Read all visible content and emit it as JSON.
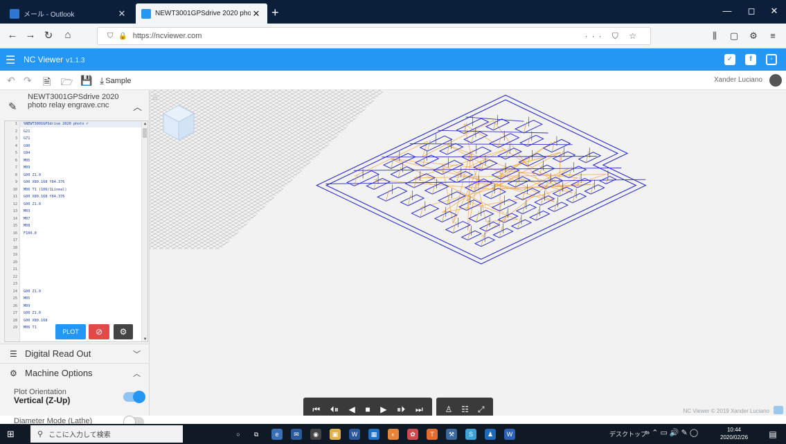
{
  "browser": {
    "tabs": [
      {
        "label": "メール - Outlook",
        "active": false
      },
      {
        "label": "NEWT3001GPSdrive 2020 pho",
        "active": true
      }
    ],
    "new_tab": "+",
    "url": "https://ncviewer.com",
    "window_controls": [
      "—",
      "◻",
      "✕"
    ]
  },
  "app": {
    "title": "NC Viewer",
    "version": "v1.1.3",
    "sample_label": "Sample",
    "user": "Xander Luciano",
    "colors": {
      "accent": "#2496f3",
      "toolpath_cut": "#2a2ad6",
      "toolpath_rapid": "#f2a23c",
      "plunge": "#c9a23a"
    }
  },
  "file": {
    "name": "NEWT3001GPSdrive 2020 photo relay engrave.cnc",
    "lines": [
      {
        "n": "1",
        "code": "%NEWT3001GPSdrive 2020 photo r"
      },
      {
        "n": "2",
        "code": "G21"
      },
      {
        "n": "3",
        "code": "G71"
      },
      {
        "n": "4",
        "code": "G90"
      },
      {
        "n": "5",
        "code": "G94"
      },
      {
        "n": "6",
        "code": "M05"
      },
      {
        "n": "7",
        "code": "M09"
      },
      {
        "n": "8",
        "code": "G00 Z1.0"
      },
      {
        "n": "9",
        "code": "G00 X80.168 Y84.376"
      },
      {
        "n": "10",
        "code": "M06 T1 (100/1Lineal)"
      },
      {
        "n": "11",
        "code": "G00 X80.168 Y84.376"
      },
      {
        "n": "12",
        "code": "G00 Z1.0"
      },
      {
        "n": "13",
        "code": "M03"
      },
      {
        "n": "14",
        "code": "M07"
      },
      {
        "n": "15",
        "code": "M08"
      },
      {
        "n": "16",
        "code": "F100.0"
      },
      {
        "n": "17",
        "code": ""
      },
      {
        "n": "18",
        "code": ""
      },
      {
        "n": "19",
        "code": ""
      },
      {
        "n": "20",
        "code": ""
      },
      {
        "n": "21",
        "code": ""
      },
      {
        "n": "22",
        "code": ""
      },
      {
        "n": "23",
        "code": ""
      },
      {
        "n": "24",
        "code": "G00 Z1.0"
      },
      {
        "n": "25",
        "code": "M05"
      },
      {
        "n": "26",
        "code": "M09"
      },
      {
        "n": "27",
        "code": "G00 Z1.0"
      },
      {
        "n": "28",
        "code": "G00 X80.168"
      },
      {
        "n": "29",
        "code": "M06 T1"
      }
    ],
    "plot_button": "PLOT"
  },
  "panels": {
    "digital_read_out": "Digital Read Out",
    "machine_options": "Machine Options",
    "plot_orientation_label": "Plot Orientation",
    "plot_orientation_value": "Vertical (Z-Up)",
    "diameter_mode_label": "Diameter Mode (Lathe)"
  },
  "viewport": {
    "credit": "NC Viewer © 2019 Xander Luciano"
  },
  "taskbar": {
    "search_placeholder": "ここに入力して検索",
    "tray_label": "デスクトップ",
    "time": "10:44",
    "date": "2020/02/26"
  }
}
